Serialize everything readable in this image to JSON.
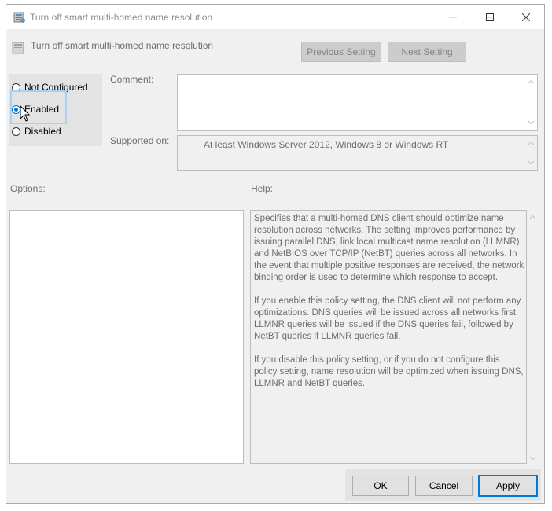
{
  "window": {
    "title": "Turn off smart multi-homed name resolution"
  },
  "header": {
    "title": "Turn off smart multi-homed name resolution",
    "previous_label": "Previous Setting",
    "next_label": "Next Setting"
  },
  "state": {
    "options": [
      {
        "label": "Not Configured",
        "checked": false
      },
      {
        "label": "Enabled",
        "checked": true
      },
      {
        "label": "Disabled",
        "checked": false
      }
    ]
  },
  "comment": {
    "label": "Comment:",
    "value": ""
  },
  "supported": {
    "label": "Supported on:",
    "value": "At least Windows Server 2012, Windows 8 or Windows RT"
  },
  "options_pane": {
    "label": "Options:"
  },
  "help_pane": {
    "label": "Help:",
    "paragraphs": [
      "Specifies that a multi-homed DNS client should optimize name resolution across networks.  The setting improves performance by issuing parallel DNS, link local multicast name resolution (LLMNR) and NetBIOS over TCP/IP (NetBT) queries across all networks. In the event that multiple positive responses are received, the network binding order is used to determine which response to accept.",
      "If you enable this policy setting, the DNS client will not perform any optimizations.  DNS queries will be issued across all networks first. LLMNR queries will be issued if the DNS queries fail, followed by NetBT queries if LLMNR queries fail.",
      "If you disable this policy setting, or if you do not configure this policy setting, name resolution will be optimized when issuing DNS, LLMNR and NetBT queries."
    ]
  },
  "footer": {
    "ok_label": "OK",
    "cancel_label": "Cancel",
    "apply_label": "Apply"
  },
  "colors": {
    "accent": "#0078d7",
    "dialog_bg": "#f0f0f0",
    "disabled_text": "#6d6d6d"
  }
}
